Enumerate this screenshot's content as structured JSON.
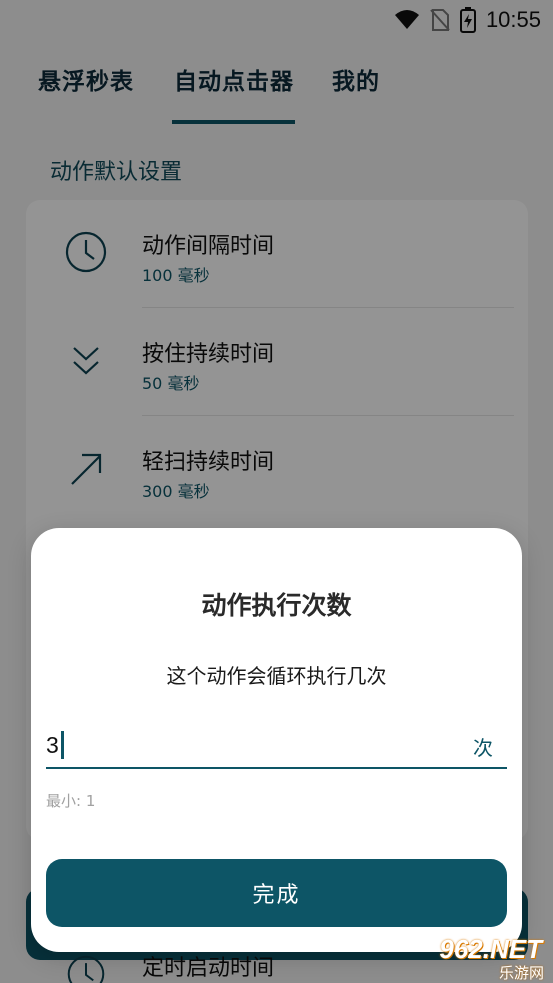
{
  "status_bar": {
    "time": "10:55",
    "icons": [
      "wifi-icon",
      "no-sim-icon",
      "battery-charging-icon"
    ]
  },
  "tabs": [
    {
      "label": "悬浮秒表"
    },
    {
      "label": "自动点击器",
      "active": true
    },
    {
      "label": "我的"
    }
  ],
  "section": {
    "title": "动作默认设置"
  },
  "settings": [
    {
      "icon": "clock-icon",
      "title": "动作间隔时间",
      "sub": "100 毫秒"
    },
    {
      "icon": "chevrons-down-icon",
      "title": "按住持续时间",
      "sub": "50 毫秒"
    },
    {
      "icon": "arrow-up-right-icon",
      "title": "轻扫持续时间",
      "sub": "300 毫秒"
    }
  ],
  "peek": {
    "icon": "clock-icon",
    "title": "定时启动时间"
  },
  "dialog": {
    "title": "动作执行次数",
    "description": "这个动作会循环执行几次",
    "input_value": "3",
    "input_suffix": "次",
    "min_hint": "最小: 1",
    "done_label": "完成"
  },
  "watermark": {
    "top": "962.NET",
    "bottom": "乐游网"
  },
  "colors": {
    "accent": "#0d5566",
    "background": "#f3f3f3",
    "scrim": "rgba(0,0,0,0.42)"
  }
}
